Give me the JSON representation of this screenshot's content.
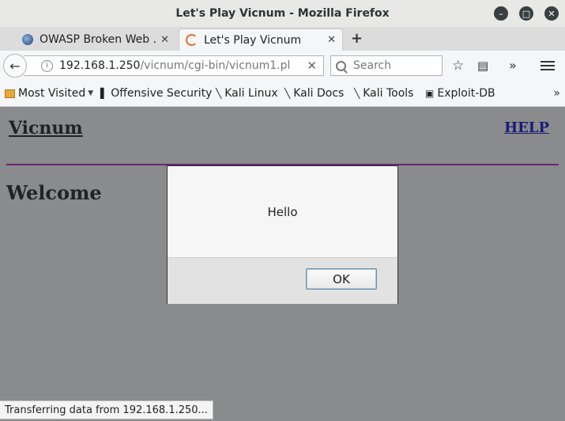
{
  "window": {
    "title": "Let's Play Vicnum - Mozilla Firefox"
  },
  "tabs": [
    {
      "label": "OWASP Broken Web ...",
      "close": "✕"
    },
    {
      "label": "Let's Play Vicnum",
      "close": "✕"
    }
  ],
  "new_tab": "+",
  "nav": {
    "url_host": "192.168.1.250",
    "url_path": "/vicnum/cgi-bin/vicnum1.pl",
    "url_clear": "✕",
    "search_placeholder": "Search"
  },
  "bookmarks": {
    "items": [
      {
        "label": "Most Visited",
        "icon": "folder-icon"
      },
      {
        "label": "Offensive Security",
        "icon": "offsec-icon"
      },
      {
        "label": "Kali Linux",
        "icon": "kali-dragon-icon"
      },
      {
        "label": "Kali Docs",
        "icon": "kali-dragon-icon"
      },
      {
        "label": "Kali Tools",
        "icon": "kali-dragon-icon"
      },
      {
        "label": "Exploit-DB",
        "icon": "exploitdb-icon"
      }
    ],
    "more": "»"
  },
  "page": {
    "logo": "Vicnum",
    "help": "HELP",
    "heading": "Welcome"
  },
  "dialog": {
    "message": "Hello",
    "ok_label": "OK"
  },
  "status": {
    "text": "Transferring data from 192.168.1.250..."
  },
  "colors": {
    "content_bg": "#8a8b8c",
    "rule": "#6e2374",
    "help_link": "#1a1a7a"
  }
}
